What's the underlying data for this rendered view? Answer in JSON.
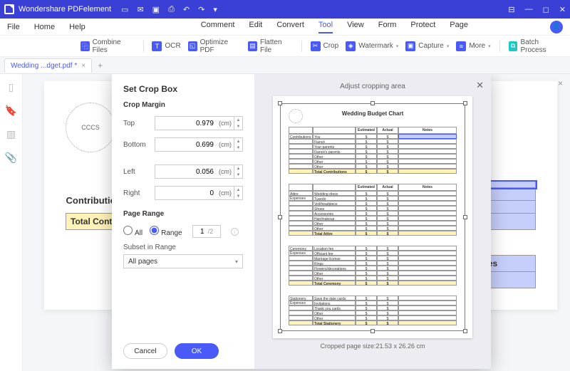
{
  "app_name": "Wondershare PDFelement",
  "menus": {
    "file": "File",
    "home": "Home",
    "help": "Help",
    "comment": "Comment",
    "edit": "Edit",
    "convert": "Convert",
    "tool": "Tool",
    "view": "View",
    "form": "Form",
    "protect": "Protect",
    "page": "Page"
  },
  "tools": {
    "combine": "Combine Files",
    "ocr": "OCR",
    "optimize": "Optimize PDF",
    "flatten": "Flatten File",
    "crop": "Crop",
    "watermark": "Watermark",
    "capture": "Capture",
    "more": "More",
    "batch": "Batch Process"
  },
  "tab": {
    "name": "Wedding ...dget.pdf *"
  },
  "dialog": {
    "title": "Set Crop Box",
    "margin_heading": "Crop Margin",
    "top_label": "Top",
    "top_value": "0.979",
    "bottom_label": "Bottom",
    "bottom_value": "0.699",
    "left_label": "Left",
    "left_value": "0.056",
    "right_label": "Right",
    "right_value": "0",
    "unit": "(cm)",
    "pagerange_heading": "Page Range",
    "all_label": "All",
    "range_label": "Range",
    "range_value": "1",
    "range_total": "/2",
    "subset_label": "Subset in Range",
    "subset_value": "All pages",
    "cancel": "Cancel",
    "ok": "OK",
    "adjust_label": "Adjust cropping area",
    "preview_title": "Wedding Budget Chart",
    "cropped_size": "Cropped page size:21.53 x 26.26 cm"
  },
  "bgdoc": {
    "contrib": "Contributic",
    "total_contrib": "Total Contri",
    "col_estimated": "Estimated",
    "col_actual": "Actual",
    "col_notes": "Notes",
    "row_wedding_dress": "Wedding dress",
    "dollar": "$"
  },
  "preview_rows": {
    "sec1_head_est": "Estimated",
    "sec1_head_act": "Actual",
    "sec1_head_notes": "Notes",
    "sec1_label": "Contributions",
    "r_you": "You",
    "r_fiance": "Fiancé",
    "r_your_parents": "Your parents",
    "r_fiance_parents": "Fiancé's parents",
    "r_o1": "Other",
    "r_o2": "Other",
    "r_o3": "Other",
    "total_contributions": "Total Contributions",
    "sec2_label": "Attire Expenses",
    "r_dress": "Wedding dress",
    "r_tux": "Tuxedo",
    "r_veil": "Veil/headpiece",
    "r_shoes": "Shoes",
    "r_acc": "Accessories",
    "r_hair": "Hair/makeup",
    "total_attire": "Total Attire",
    "sec3_label": "Ceremony Expenses",
    "r_loc": "Location fee",
    "r_off": "Officiant fee",
    "r_lic": "Marriage license",
    "r_rings": "Rings",
    "r_flowers": "Flowers/decorations",
    "total_ceremony": "Total Ceremony",
    "sec4_label": "Stationery Expenses",
    "r_std": "Save the date cards",
    "r_inv": "Invitations",
    "r_ty": "Thank you cards",
    "total_stationery": "Total Stationery"
  }
}
